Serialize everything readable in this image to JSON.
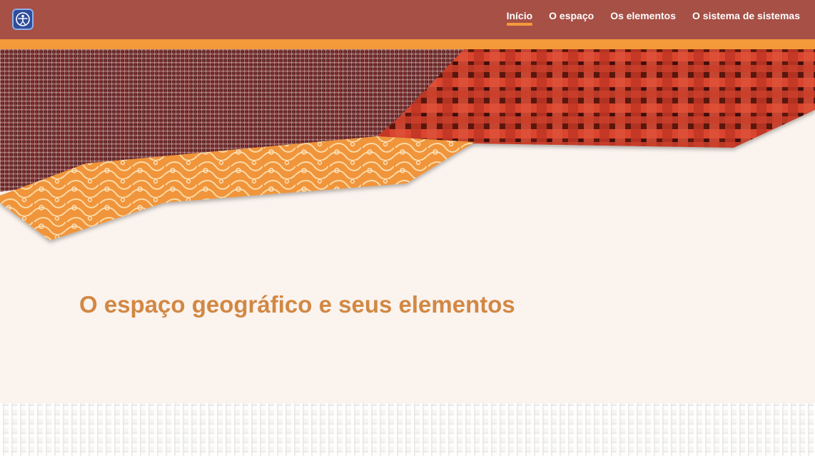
{
  "header": {
    "logo_icon": "vitruvian-man-icon",
    "nav": [
      {
        "label": "Início",
        "active": true
      },
      {
        "label": "O espaço",
        "active": false
      },
      {
        "label": "Os elementos",
        "active": false
      },
      {
        "label": "O sistema de sistemas",
        "active": false
      }
    ]
  },
  "main": {
    "title": "O espaço geográfico e seus elementos"
  },
  "colors": {
    "header_bg": "#a65046",
    "accent": "#f49a3a",
    "page_bg": "#fbf3ee",
    "title": "#d18844"
  }
}
